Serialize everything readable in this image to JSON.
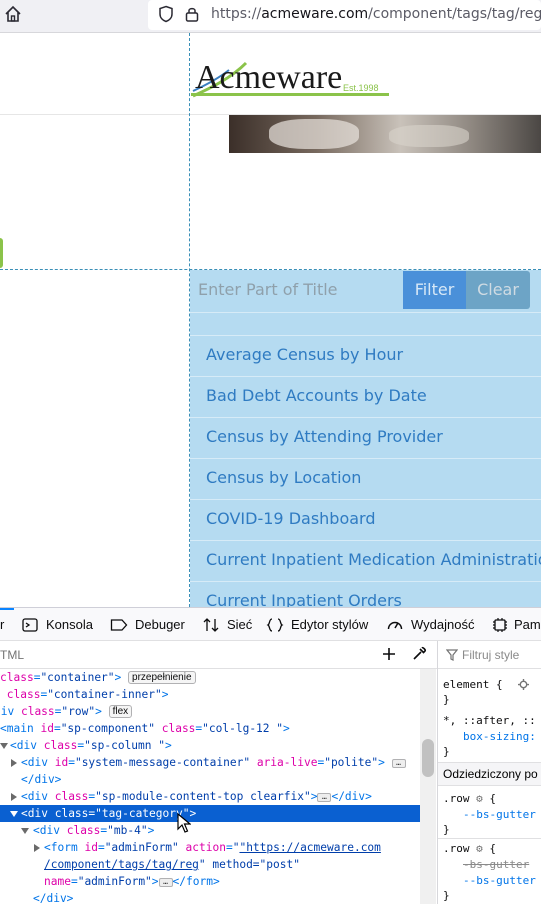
{
  "browser": {
    "url_prefix": "https://",
    "url_domain": "acmeware.com",
    "url_path": "/component/tags/tag/reg"
  },
  "page": {
    "logo_text": "Acmeware",
    "logo_tagline": "Est.1998",
    "filter_placeholder": "Enter Part of Title",
    "filter_button": "Filter",
    "clear_button": "Clear",
    "tags": [
      "Average Census by Hour",
      "Bad Debt Accounts by Date",
      "Census by Attending Provider",
      "Census by Location",
      "COVID-19 Dashboard",
      "Current Inpatient Medication Administrations",
      "Current Inpatient Orders"
    ]
  },
  "devtools": {
    "tabs": {
      "inspector_fragment": "r",
      "console": "Konsola",
      "debugger": "Debuger",
      "network": "Sieć",
      "style_editor": "Edytor stylów",
      "performance": "Wydajność",
      "memory_fragment": "Pam"
    },
    "html_search_placeholder": "TML",
    "badges": {
      "overflow": "przepełnienie",
      "flex": "flex"
    },
    "tree": {
      "l1": [
        "class",
        "\"container\""
      ],
      "l2": [
        "class",
        "\"container-inner\""
      ],
      "l3": [
        "div",
        "class",
        "\"row\""
      ],
      "l4": [
        "main",
        "id",
        "\"sp-component\"",
        "class",
        "\"col-lg-12 \""
      ],
      "l5": [
        "div",
        "class",
        "\"sp-column \""
      ],
      "l6": [
        "div",
        "id",
        "\"system-message-container\"",
        "aria-live",
        "\"polite\""
      ],
      "l7": [
        "</div>"
      ],
      "l8": [
        "div",
        "class",
        "\"sp-module-content-top clearfix\"",
        "</div>"
      ],
      "l9": [
        "div",
        "class",
        "\"tag-category\""
      ],
      "l10": [
        "div",
        "class",
        "\"mb-4\""
      ],
      "l11": [
        "form",
        "id",
        "\"adminForm\"",
        "action",
        "\"https://acmeware.com",
        "/component/tags/tag/reg",
        "\" method=",
        "\"post\""
      ],
      "l12": [
        "name",
        "\"adminForm\"",
        "</form>"
      ],
      "l13": [
        "</div>"
      ]
    },
    "rules": {
      "filter_placeholder": "Filtruj style",
      "element": "element {",
      "close": "}",
      "universal": "*, ::after, ::",
      "box_sizing": "box-sizing:",
      "inherited": "Odziedziczony po",
      "row_selector": ".row",
      "bs_gutter": "--bs-gutter",
      "bs_gutter_struck": "-bs-gutter"
    }
  }
}
